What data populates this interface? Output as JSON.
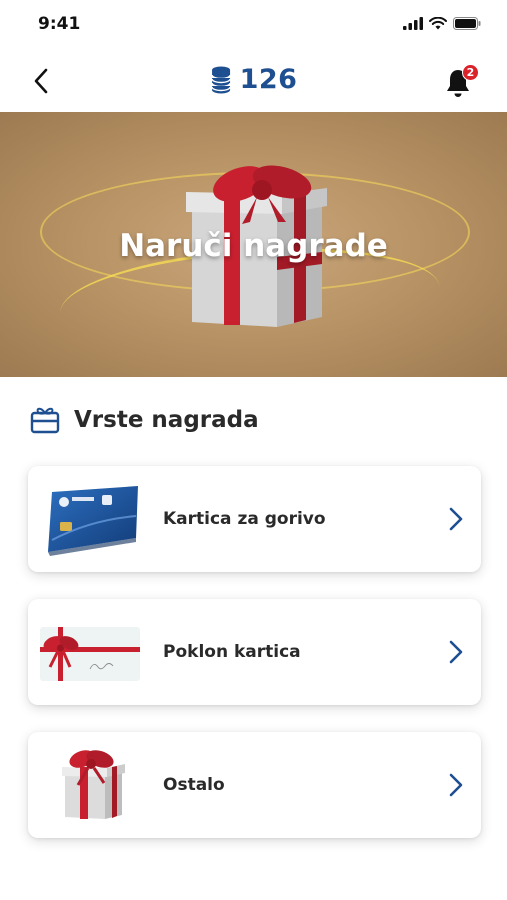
{
  "status_bar": {
    "time": "9:41"
  },
  "header": {
    "points": "126",
    "notifications_count": "2",
    "icons": {
      "back": "chevron-left-icon",
      "coins": "coins-icon",
      "bell": "bell-icon"
    }
  },
  "hero": {
    "title": "Naruči nagrade"
  },
  "section": {
    "title": "Vrste nagrada",
    "icon": "gift-card-icon"
  },
  "rewards": [
    {
      "label": "Kartica za gorivo",
      "thumb": "fuel-card-image"
    },
    {
      "label": "Poklon kartica",
      "thumb": "gift-card-image"
    },
    {
      "label": "Ostalo",
      "thumb": "gift-box-image"
    }
  ],
  "colors": {
    "brand_blue": "#1e4f91",
    "badge_red": "#d9222a",
    "ribbon_red": "#c8202e"
  }
}
